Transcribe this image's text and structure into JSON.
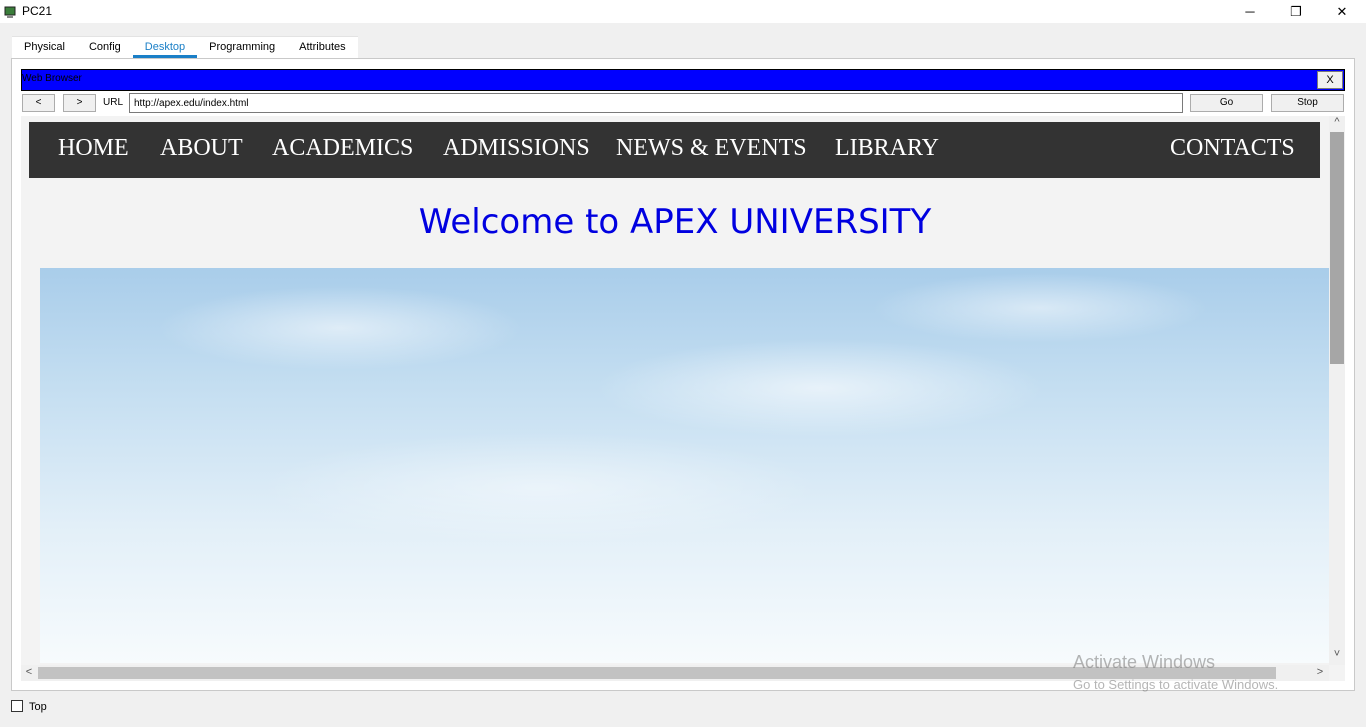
{
  "window": {
    "title": "PC21",
    "minimize_glyph": "─",
    "restore_glyph": "❐",
    "close_glyph": "✕"
  },
  "tabs": [
    {
      "label": "Physical"
    },
    {
      "label": "Config"
    },
    {
      "label": "Desktop",
      "active": true
    },
    {
      "label": "Programming"
    },
    {
      "label": "Attributes"
    }
  ],
  "browser": {
    "title": "Web Browser",
    "close_label": "X",
    "back_label": "<",
    "forward_label": ">",
    "url_label": "URL",
    "url_value": "http://apex.edu/index.html",
    "go_label": "Go",
    "stop_label": "Stop"
  },
  "site": {
    "nav": [
      "HOME",
      "ABOUT",
      "ACADEMICS",
      "ADMISSIONS",
      "NEWS & EVENTS",
      "LIBRARY",
      "CONTACTS"
    ],
    "welcome": "Welcome to APEX UNIVERSITY"
  },
  "scroll": {
    "up": "^",
    "down": "˅",
    "left": "<",
    "right": ">"
  },
  "watermark": {
    "line1": "Activate Windows",
    "line2": "Go to Settings to activate Windows."
  },
  "footer": {
    "top_label": "Top"
  },
  "colors": {
    "browser_titlebar": "#0000ff",
    "site_nav_bg": "#333333",
    "welcome_text": "#0000e0",
    "active_tab": "#1a7fc7"
  }
}
